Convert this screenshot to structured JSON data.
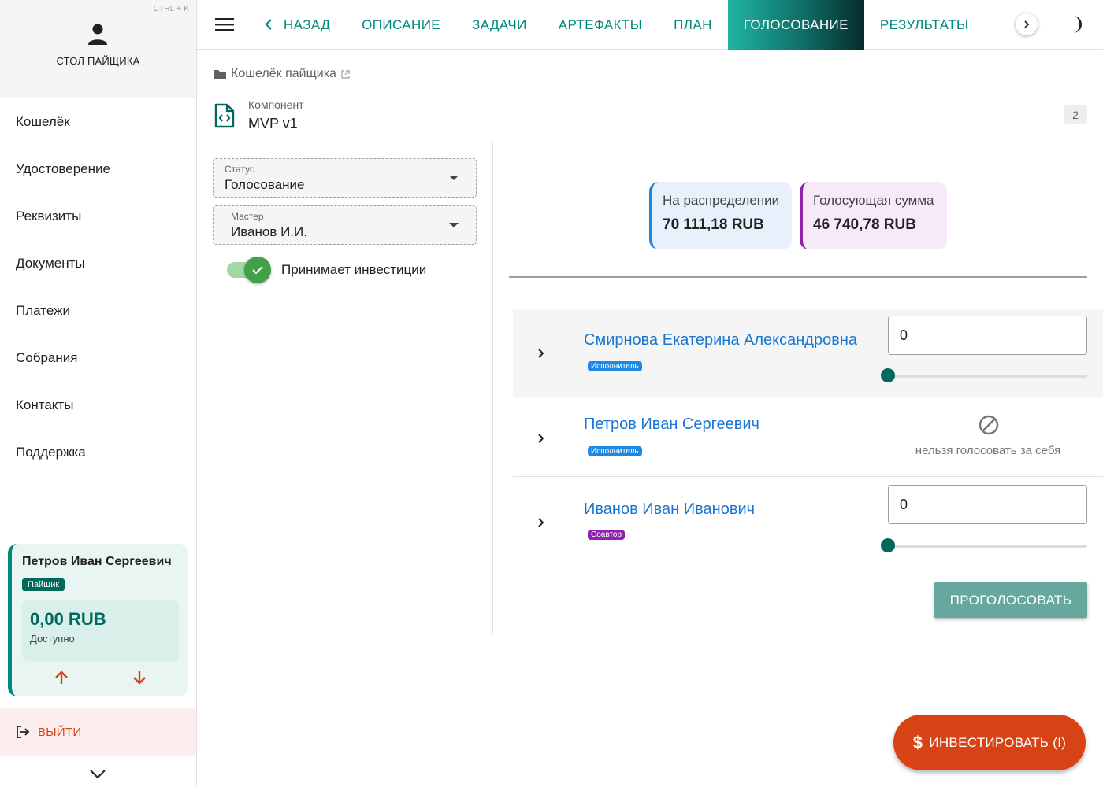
{
  "sidebar": {
    "shortcut": "CTRL + K",
    "title": "СТОЛ ПАЙЩИКА",
    "items": [
      {
        "label": "Кошелёк",
        "name": "sidebar-item-wallet"
      },
      {
        "label": "Удостоверение",
        "name": "sidebar-item-certificate"
      },
      {
        "label": "Реквизиты",
        "name": "sidebar-item-requisites"
      },
      {
        "label": "Документы",
        "name": "sidebar-item-documents"
      },
      {
        "label": "Платежи",
        "name": "sidebar-item-payments"
      },
      {
        "label": "Собрания",
        "name": "sidebar-item-meetings"
      },
      {
        "label": "Контакты",
        "name": "sidebar-item-contacts"
      },
      {
        "label": "Поддержка",
        "name": "sidebar-item-support"
      }
    ],
    "user_card": {
      "name": "Петров Иван Сергеевич",
      "role": "Пайщик",
      "balance": "0,00 RUB",
      "balance_label": "Доступно",
      "accent_color": "#00897b"
    },
    "logout_label": "ВЫЙТИ"
  },
  "topbar": {
    "back_label": "НАЗАД",
    "tabs": [
      {
        "label": "ОПИСАНИЕ",
        "active": false,
        "name": "tab-description"
      },
      {
        "label": "ЗАДАЧИ",
        "active": false,
        "name": "tab-tasks"
      },
      {
        "label": "АРТЕФАКТЫ",
        "active": false,
        "name": "tab-artifacts"
      },
      {
        "label": "ПЛАН",
        "active": false,
        "name": "tab-plan"
      },
      {
        "label": "ГОЛОСОВАНИЕ",
        "active": true,
        "name": "tab-voting"
      },
      {
        "label": "РЕЗУЛЬТАТЫ",
        "active": false,
        "name": "tab-results"
      }
    ],
    "icons": {
      "menu": "hamburger-menu-icon",
      "next": "chevron-right-icon",
      "theme": "moon-icon"
    }
  },
  "breadcrumb": {
    "label": "Кошелёк пайщика"
  },
  "component": {
    "label": "Компонент",
    "name": "MVP v1",
    "count": "2"
  },
  "filters": {
    "status": {
      "label": "Статус",
      "value": "Голосование"
    },
    "master": {
      "label": "Мастер",
      "value": "Иванов И.И."
    },
    "investments_toggle": {
      "label": "Принимает инвестиции",
      "on": true
    }
  },
  "stats": {
    "distribution": {
      "label": "На распределении",
      "value": "70 111,18 RUB",
      "color": "#1e88e5"
    },
    "voting_sum": {
      "label": "Голосующая сумма",
      "value": "46 740,78 RUB",
      "color": "#8e24aa"
    }
  },
  "voters": [
    {
      "name": "Смирнова Екатерина Александровна",
      "role": "Исполнитель",
      "role_color": "#1e88e5",
      "can_vote": true,
      "value": "0",
      "slider_fraction": 0
    },
    {
      "name": "Петров Иван Сергеевич",
      "role": "Исполнитель",
      "role_color": "#1e88e5",
      "can_vote": false,
      "blocked_text": "нельзя голосовать за себя"
    },
    {
      "name": "Иванов Иван Иванович",
      "role": "Соавтор",
      "role_color": "#8e24aa",
      "can_vote": true,
      "value": "0",
      "slider_fraction": 0
    }
  ],
  "vote_button_label": "ПРОГОЛОСОВАТЬ",
  "fab": {
    "icon": "$",
    "label": "ИНВЕСТИРОВАТЬ (I)",
    "color": "#d84315"
  }
}
